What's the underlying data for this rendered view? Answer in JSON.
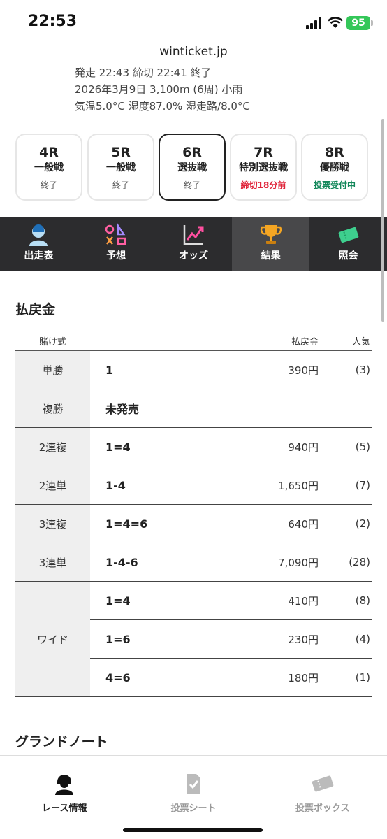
{
  "status": {
    "time": "22:53",
    "battery": "95"
  },
  "browser": {
    "url": "winticket.jp"
  },
  "race_info": {
    "line1": "発走 22:43 締切 22:41  終了",
    "line2": "2026年3月9日 3,100m (6周) 小雨",
    "line3": "気温5.0°C 湿度87.0% 湿走路/8.0°C"
  },
  "races": [
    {
      "num": "4R",
      "name": "一般戦",
      "status": "終了"
    },
    {
      "num": "5R",
      "name": "一般戦",
      "status": "終了"
    },
    {
      "num": "6R",
      "name": "選抜戦",
      "status": "終了"
    },
    {
      "num": "7R",
      "name": "特別選抜戦",
      "status": "締切18分前"
    },
    {
      "num": "8R",
      "name": "優勝戦",
      "status": "投票受付中"
    }
  ],
  "tabs": [
    {
      "label": "出走表",
      "icon": "racer-icon"
    },
    {
      "label": "予想",
      "icon": "prediction-icon"
    },
    {
      "label": "オッズ",
      "icon": "odds-chart-icon"
    },
    {
      "label": "結果",
      "icon": "trophy-icon"
    },
    {
      "label": "照会",
      "icon": "ticket-icon"
    }
  ],
  "payout": {
    "title": "払戻金",
    "headers": {
      "type": "賭け式",
      "amount": "払戻金",
      "popularity": "人気"
    },
    "rows": [
      {
        "type": "単勝",
        "combo": "1",
        "amount": "390円",
        "pop": "(3)"
      },
      {
        "type": "複勝",
        "combo": "未発売",
        "amount": "",
        "pop": ""
      },
      {
        "type": "2連複",
        "combo": "1=4",
        "amount": "940円",
        "pop": "(5)"
      },
      {
        "type": "2連単",
        "combo": "1-4",
        "amount": "1,650円",
        "pop": "(7)"
      },
      {
        "type": "3連複",
        "combo": "1=4=6",
        "amount": "640円",
        "pop": "(2)"
      },
      {
        "type": "3連単",
        "combo": "1-4-6",
        "amount": "7,090円",
        "pop": "(28)"
      }
    ],
    "wide": {
      "type": "ワイド",
      "rows": [
        {
          "combo": "1=4",
          "amount": "410円",
          "pop": "(8)"
        },
        {
          "combo": "1=6",
          "amount": "230円",
          "pop": "(4)"
        },
        {
          "combo": "4=6",
          "amount": "180円",
          "pop": "(1)"
        }
      ]
    }
  },
  "next_section": {
    "title": "グランドノート"
  },
  "bottom_nav": [
    {
      "label": "レース情報",
      "icon": "racer-icon"
    },
    {
      "label": "投票シート",
      "icon": "betting-sheet-icon"
    },
    {
      "label": "投票ボックス",
      "icon": "ticket-icon"
    }
  ],
  "colors": {
    "accent_red": "#e0243a",
    "accent_green": "#12875a",
    "tab_bar": "#2c2c2e",
    "battery": "#34c759"
  }
}
